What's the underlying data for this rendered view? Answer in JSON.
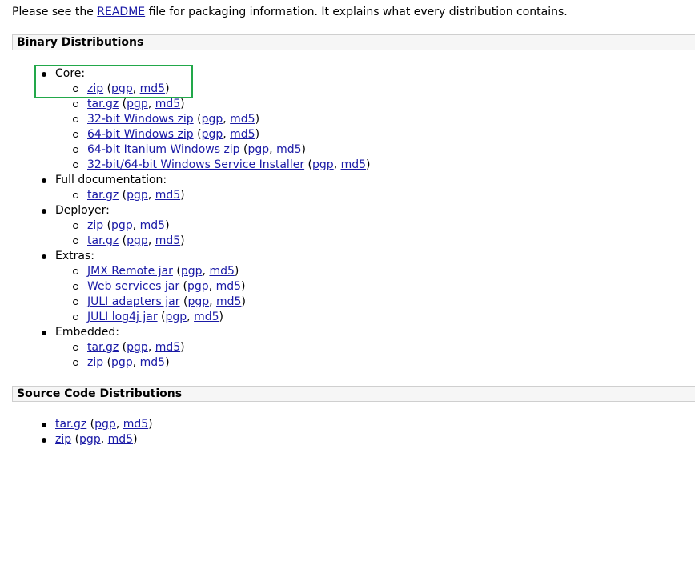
{
  "intro": {
    "prefix": "Please see the ",
    "link": "README",
    "suffix": " file for packaging information. It explains what every distribution contains."
  },
  "binary": {
    "title": "Binary Distributions",
    "groups": [
      {
        "label": "Core:",
        "items": [
          {
            "name": "zip",
            "pgp": "pgp",
            "md5": "md5"
          },
          {
            "name": "tar.gz",
            "pgp": "pgp",
            "md5": "md5"
          },
          {
            "name": "32-bit Windows zip",
            "pgp": "pgp",
            "md5": "md5"
          },
          {
            "name": "64-bit Windows zip",
            "pgp": "pgp",
            "md5": "md5"
          },
          {
            "name": "64-bit Itanium Windows zip",
            "pgp": "pgp",
            "md5": "md5"
          },
          {
            "name": "32-bit/64-bit Windows Service Installer",
            "pgp": "pgp",
            "md5": "md5"
          }
        ]
      },
      {
        "label": "Full documentation:",
        "items": [
          {
            "name": "tar.gz",
            "pgp": "pgp",
            "md5": "md5"
          }
        ]
      },
      {
        "label": "Deployer:",
        "items": [
          {
            "name": "zip",
            "pgp": "pgp",
            "md5": "md5"
          },
          {
            "name": "tar.gz",
            "pgp": "pgp",
            "md5": "md5"
          }
        ]
      },
      {
        "label": "Extras:",
        "items": [
          {
            "name": "JMX Remote jar",
            "pgp": "pgp",
            "md5": "md5"
          },
          {
            "name": "Web services jar",
            "pgp": "pgp",
            "md5": "md5"
          },
          {
            "name": "JULI adapters jar",
            "pgp": "pgp",
            "md5": "md5"
          },
          {
            "name": "JULI log4j jar",
            "pgp": "pgp",
            "md5": "md5"
          }
        ]
      },
      {
        "label": "Embedded:",
        "items": [
          {
            "name": "tar.gz",
            "pgp": "pgp",
            "md5": "md5"
          },
          {
            "name": "zip",
            "pgp": "pgp",
            "md5": "md5"
          }
        ]
      }
    ]
  },
  "source": {
    "title": "Source Code Distributions",
    "items": [
      {
        "name": "tar.gz",
        "pgp": "pgp",
        "md5": "md5"
      },
      {
        "name": "zip",
        "pgp": "pgp",
        "md5": "md5"
      }
    ]
  },
  "colors": {
    "link": "#1a1aa6",
    "highlight": "#22a84a"
  }
}
